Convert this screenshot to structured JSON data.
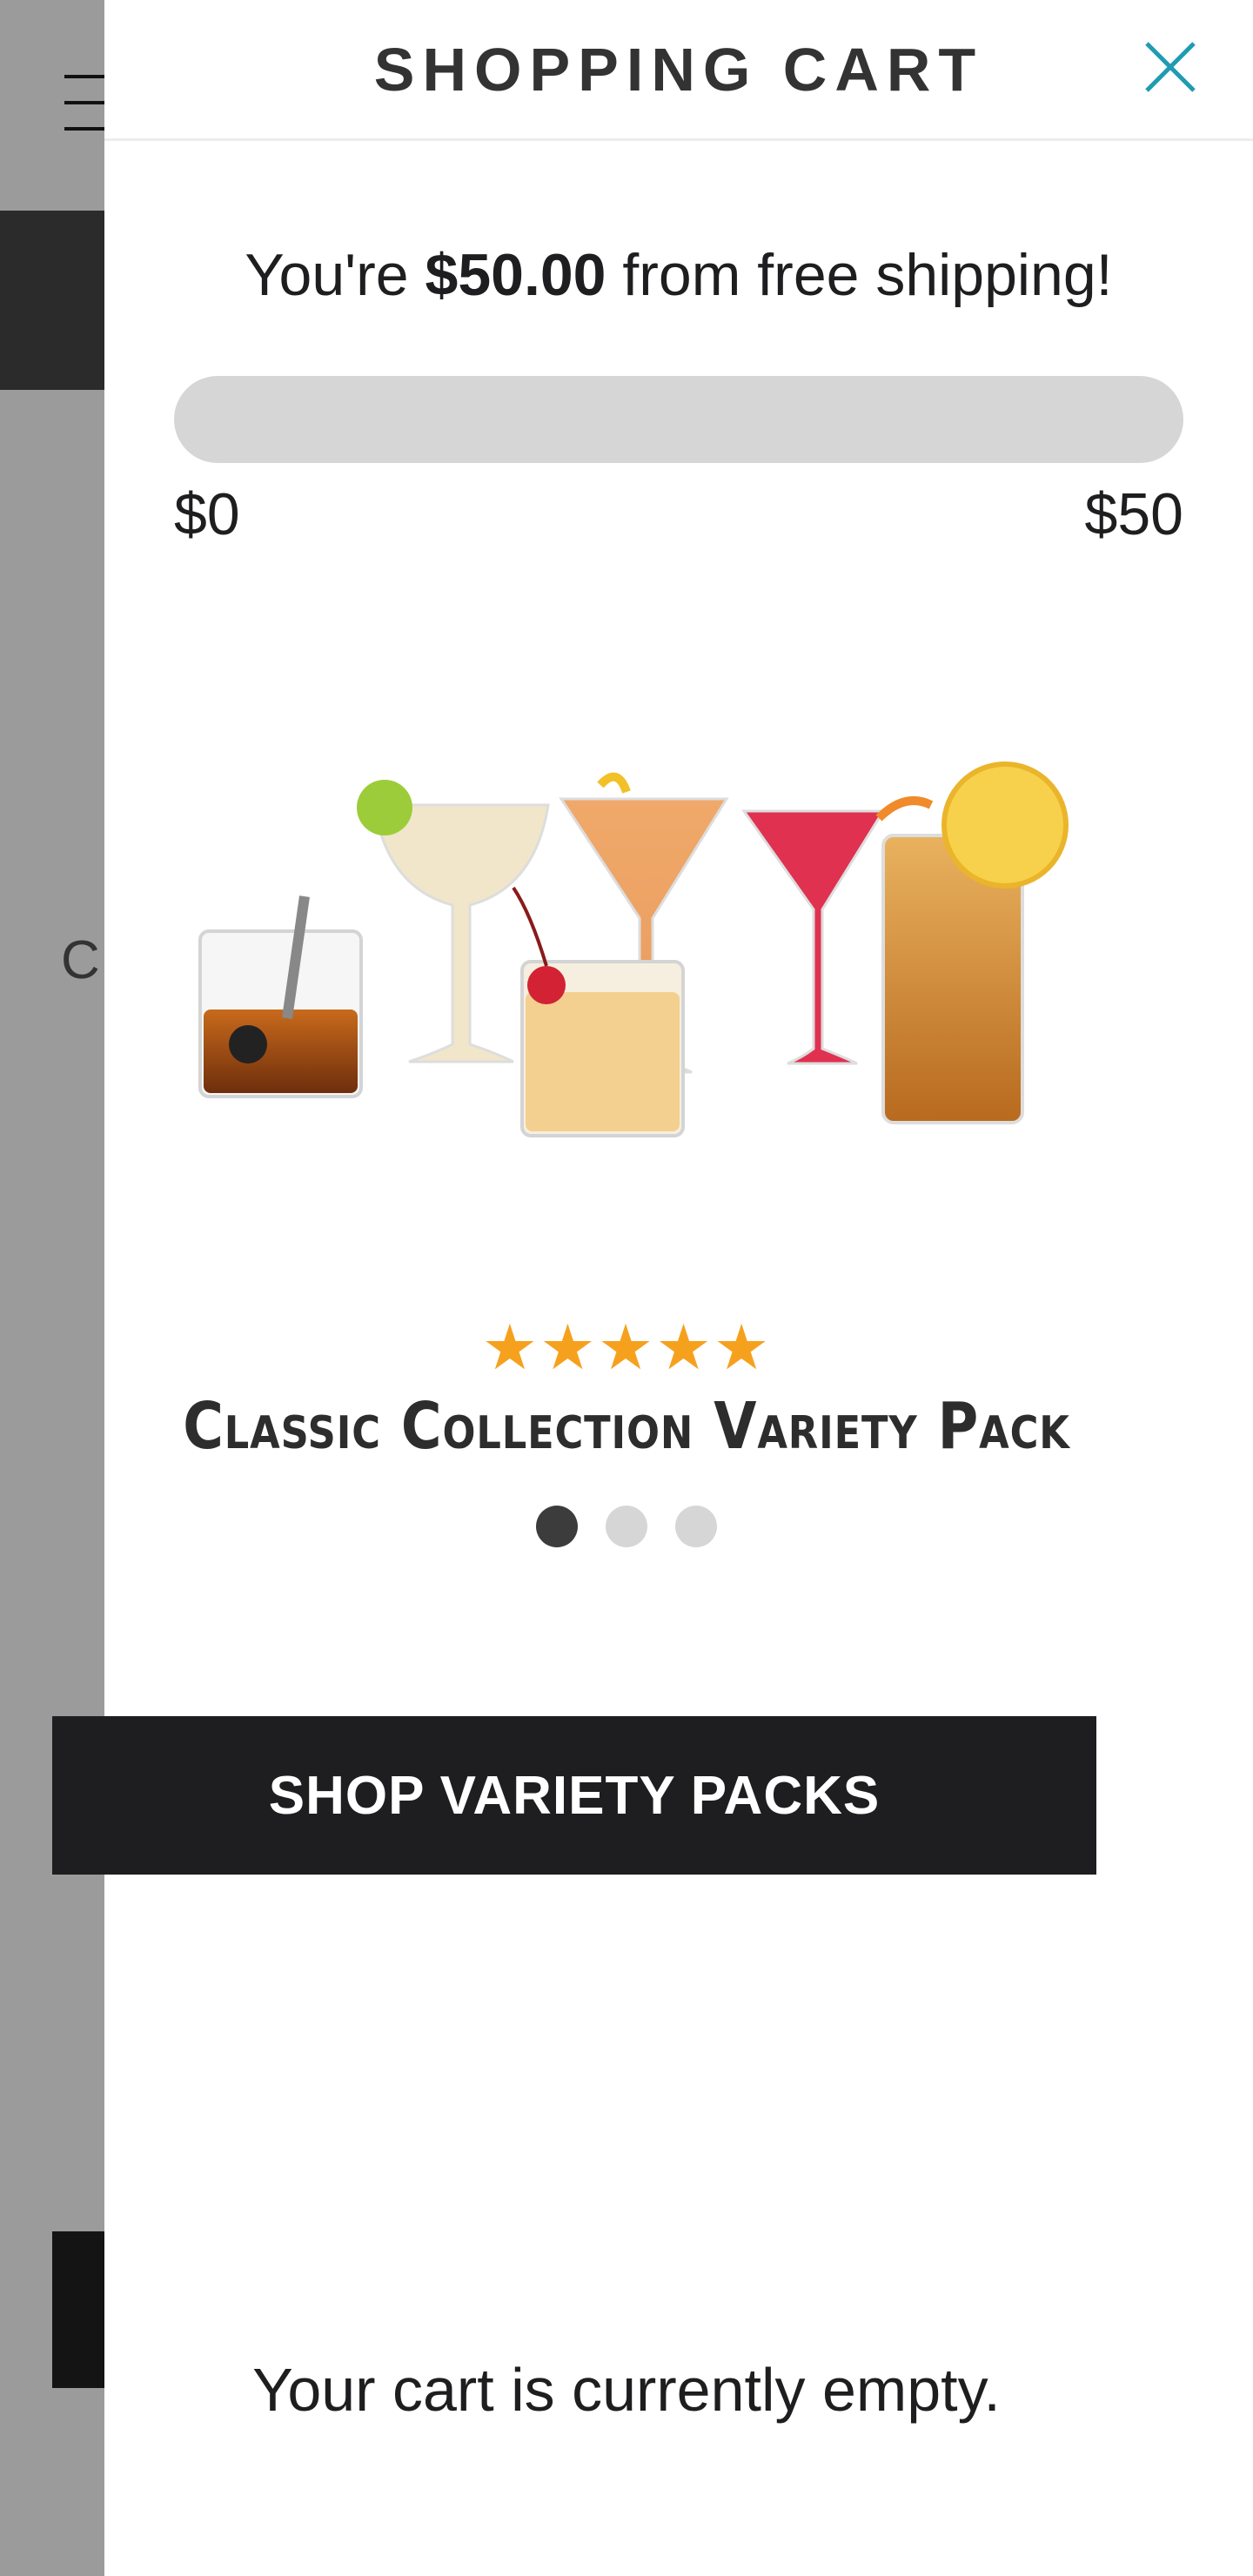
{
  "background_page": {
    "partial_letter": "C"
  },
  "cart": {
    "title": "SHOPPING CART",
    "shipping_prefix": "You're ",
    "shipping_amount": "$50.00",
    "shipping_suffix": " from free shipping!",
    "progress": {
      "fraction": 0,
      "min_label": "$0",
      "max_label": "$50"
    },
    "product": {
      "rating_stars": "★★★★★",
      "rating": 5,
      "name": "Classic Collection Variety Pack",
      "image_icon": "cocktail-glasses-photo"
    },
    "carousel": {
      "slide_count": 3,
      "active_index": 0
    },
    "shop_button_label": "SHOP VARIETY PACKS",
    "empty_message": "Your cart is currently empty."
  },
  "colors": {
    "accent_close": "#1f9bb3",
    "button_bg": "#1e1e20",
    "star": "#f6a11e",
    "progress_track": "#d6d6d6"
  },
  "icons": {
    "close": "close-icon",
    "menu": "hamburger-menu-icon"
  }
}
